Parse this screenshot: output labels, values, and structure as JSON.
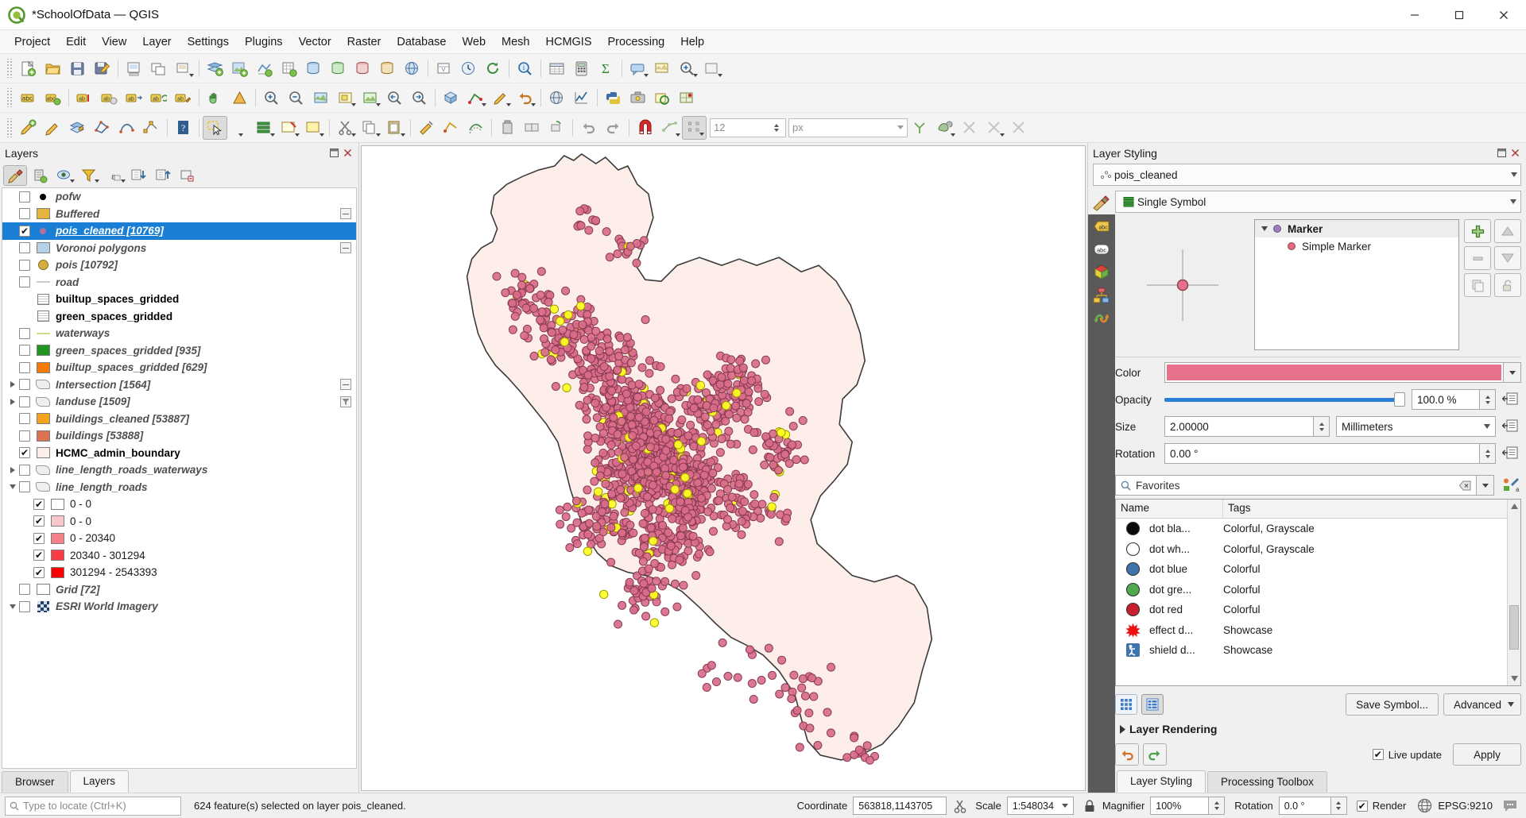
{
  "window": {
    "title": "*SchoolOfData — QGIS",
    "minimize": "─",
    "maximize": "▢",
    "close": "✕"
  },
  "menubar": [
    "Project",
    "Edit",
    "View",
    "Layer",
    "Settings",
    "Plugins",
    "Vector",
    "Raster",
    "Database",
    "Web",
    "Mesh",
    "HCMGIS",
    "Processing",
    "Help"
  ],
  "toolbar_digitizing": {
    "size_value": "12",
    "units_value": "px",
    "overflow_label": "»"
  },
  "layers_panel": {
    "title": "Layers",
    "tabs": [
      {
        "label": "Browser",
        "active": false
      },
      {
        "label": "Layers",
        "active": true
      }
    ],
    "items": [
      {
        "name": "pofw",
        "checked": false,
        "symbol": "dot",
        "color": "#000000",
        "indent": 1,
        "expander": "none",
        "style": "italic"
      },
      {
        "name": "Buffered",
        "checked": false,
        "symbol": "swatch",
        "color": "#e6b33c",
        "indent": 1,
        "expander": "none",
        "style": "italic",
        "tail": "minus"
      },
      {
        "name": "pois_cleaned [10769]",
        "checked": true,
        "symbol": "dot",
        "color": "#b0729a",
        "indent": 1,
        "expander": "none",
        "style": "italic",
        "selected": true
      },
      {
        "name": "Voronoi polygons",
        "checked": false,
        "symbol": "swatch",
        "color": "#b6d0e7",
        "indent": 1,
        "expander": "none",
        "style": "italic",
        "tail": "minus"
      },
      {
        "name": "pois [10792]",
        "checked": false,
        "symbol": "bigdot",
        "color": "#d4ae3f",
        "indent": 1,
        "expander": "none",
        "style": "italic"
      },
      {
        "name": "road",
        "checked": false,
        "symbol": "line",
        "color": "#c9c9c9",
        "indent": 1,
        "expander": "none",
        "style": "italic"
      },
      {
        "name": "builtup_spaces_gridded",
        "checked": null,
        "symbol": "table",
        "color": "",
        "indent": 1,
        "expander": "none",
        "style": "bold-black"
      },
      {
        "name": "green_spaces_gridded",
        "checked": null,
        "symbol": "table",
        "color": "",
        "indent": 1,
        "expander": "none",
        "style": "bold-black"
      },
      {
        "name": "waterways",
        "checked": false,
        "symbol": "line",
        "color": "#cddb8a",
        "indent": 1,
        "expander": "none",
        "style": "italic"
      },
      {
        "name": "green_spaces_gridded [935]",
        "checked": false,
        "symbol": "swatch",
        "color": "#1f9620",
        "indent": 1,
        "expander": "none",
        "style": "italic"
      },
      {
        "name": "builtup_spaces_gridded [629]",
        "checked": false,
        "symbol": "swatch",
        "color": "#f57a08",
        "indent": 1,
        "expander": "none",
        "style": "italic"
      },
      {
        "name": "Intersection [1564]",
        "checked": false,
        "symbol": "poly",
        "color": "",
        "indent": 1,
        "expander": "right",
        "style": "italic",
        "tail": "minus"
      },
      {
        "name": "landuse [1509]",
        "checked": false,
        "symbol": "poly",
        "color": "",
        "indent": 1,
        "expander": "right",
        "style": "italic",
        "tail": "filter"
      },
      {
        "name": "buildings_cleaned [53887]",
        "checked": false,
        "symbol": "swatch",
        "color": "#f5a21d",
        "indent": 1,
        "expander": "none",
        "style": "italic"
      },
      {
        "name": "buildings [53888]",
        "checked": false,
        "symbol": "swatch",
        "color": "#db7250",
        "indent": 1,
        "expander": "none",
        "style": "italic"
      },
      {
        "name": "HCMC_admin_boundary",
        "checked": true,
        "symbol": "swatch",
        "color": "#fdeeea",
        "indent": 1,
        "expander": "none",
        "style": "bold-black"
      },
      {
        "name": "line_length_roads_waterways",
        "checked": false,
        "symbol": "poly",
        "color": "",
        "indent": 1,
        "expander": "right",
        "style": "italic"
      },
      {
        "name": "line_length_roads",
        "checked": false,
        "symbol": "poly",
        "color": "",
        "indent": 1,
        "expander": "down",
        "style": "italic"
      },
      {
        "name": "0 - 0",
        "checked": true,
        "symbol": "swatch",
        "color": "#ffffff",
        "indent": 2,
        "expander": "none",
        "style": "plain"
      },
      {
        "name": "0 - 0",
        "checked": true,
        "symbol": "swatch",
        "color": "#f8c6cb",
        "indent": 2,
        "expander": "none",
        "style": "plain"
      },
      {
        "name": "0 - 20340",
        "checked": true,
        "symbol": "swatch",
        "color": "#f4808a",
        "indent": 2,
        "expander": "none",
        "style": "plain"
      },
      {
        "name": "20340 - 301294",
        "checked": true,
        "symbol": "swatch",
        "color": "#f83b44",
        "indent": 2,
        "expander": "none",
        "style": "plain"
      },
      {
        "name": "301294 - 2543393",
        "checked": true,
        "symbol": "swatch",
        "color": "#fa0000",
        "indent": 2,
        "expander": "none",
        "style": "plain"
      },
      {
        "name": "Grid [72]",
        "checked": false,
        "symbol": "swatch",
        "color": "#ffffff",
        "indent": 1,
        "expander": "none",
        "style": "italic"
      },
      {
        "name": "ESRI World Imagery",
        "checked": false,
        "symbol": "raster",
        "color": "",
        "indent": 1,
        "expander": "down",
        "style": "italic"
      }
    ]
  },
  "layer_styling": {
    "title": "Layer Styling",
    "layer_name": "pois_cleaned",
    "renderer": "Single Symbol",
    "symbol_tree": [
      {
        "label": "Marker",
        "level": 0,
        "color": "#9d7fbd",
        "bold": true
      },
      {
        "label": "Simple Marker",
        "level": 1,
        "color": "#e4697f",
        "bold": false
      }
    ],
    "properties": {
      "color_label": "Color",
      "color_value": "#e8728c",
      "opacity_label": "Opacity",
      "opacity_value": "100.0 %",
      "size_label": "Size",
      "size_value": "2.00000",
      "size_unit": "Millimeters",
      "rotation_label": "Rotation",
      "rotation_value": "0.00 °"
    },
    "search_placeholder": "Favorites",
    "symbol_table": {
      "columns": [
        "Name",
        "Tags"
      ],
      "rows": [
        {
          "name": "dot  bla...",
          "tags": "Colorful, Grayscale",
          "color": "#0a0a0a",
          "shape": "circle"
        },
        {
          "name": "dot  wh...",
          "tags": "Colorful, Grayscale",
          "color": "#ffffff",
          "shape": "circle"
        },
        {
          "name": "dot blue",
          "tags": "Colorful",
          "color": "#3f74ad",
          "shape": "circle"
        },
        {
          "name": "dot gre...",
          "tags": "Colorful",
          "color": "#4fa94f",
          "shape": "circle"
        },
        {
          "name": "dot red",
          "tags": "Colorful",
          "color": "#c91f2e",
          "shape": "circle"
        },
        {
          "name": "effect d...",
          "tags": "Showcase",
          "color": "#ee1111",
          "shape": "star"
        },
        {
          "name": "shield d...",
          "tags": "Showcase",
          "color": "#3f74ad",
          "shape": "shield"
        }
      ]
    },
    "save_symbol_label": "Save Symbol...",
    "advanced_label": "Advanced",
    "layer_rendering_label": "Layer Rendering",
    "live_update_label": "Live update",
    "live_update_checked": true,
    "apply_label": "Apply",
    "tabs": [
      {
        "label": "Layer Styling",
        "active": true
      },
      {
        "label": "Processing Toolbox",
        "active": false
      }
    ]
  },
  "statusbar": {
    "locator_placeholder": "Type to locate (Ctrl+K)",
    "message": "624 feature(s) selected on layer pois_cleaned.",
    "coordinate_label": "Coordinate",
    "coordinate_value": "563818,1143705",
    "scale_label": "Scale",
    "scale_value": "1:548034",
    "magnifier_label": "Magnifier",
    "magnifier_value": "100%",
    "rotation_label": "Rotation",
    "rotation_value": "0.0 °",
    "render_label": "Render",
    "render_checked": true,
    "crs_label": "EPSG:9210"
  },
  "map": {
    "boundary_fill": "#fdeeea",
    "boundary_stroke": "#3d3d3d",
    "point_fill": "#d96d8a",
    "point_stroke": "#8a3b52",
    "selected_fill": "#ffff22",
    "selected_stroke": "#9a9a00"
  }
}
